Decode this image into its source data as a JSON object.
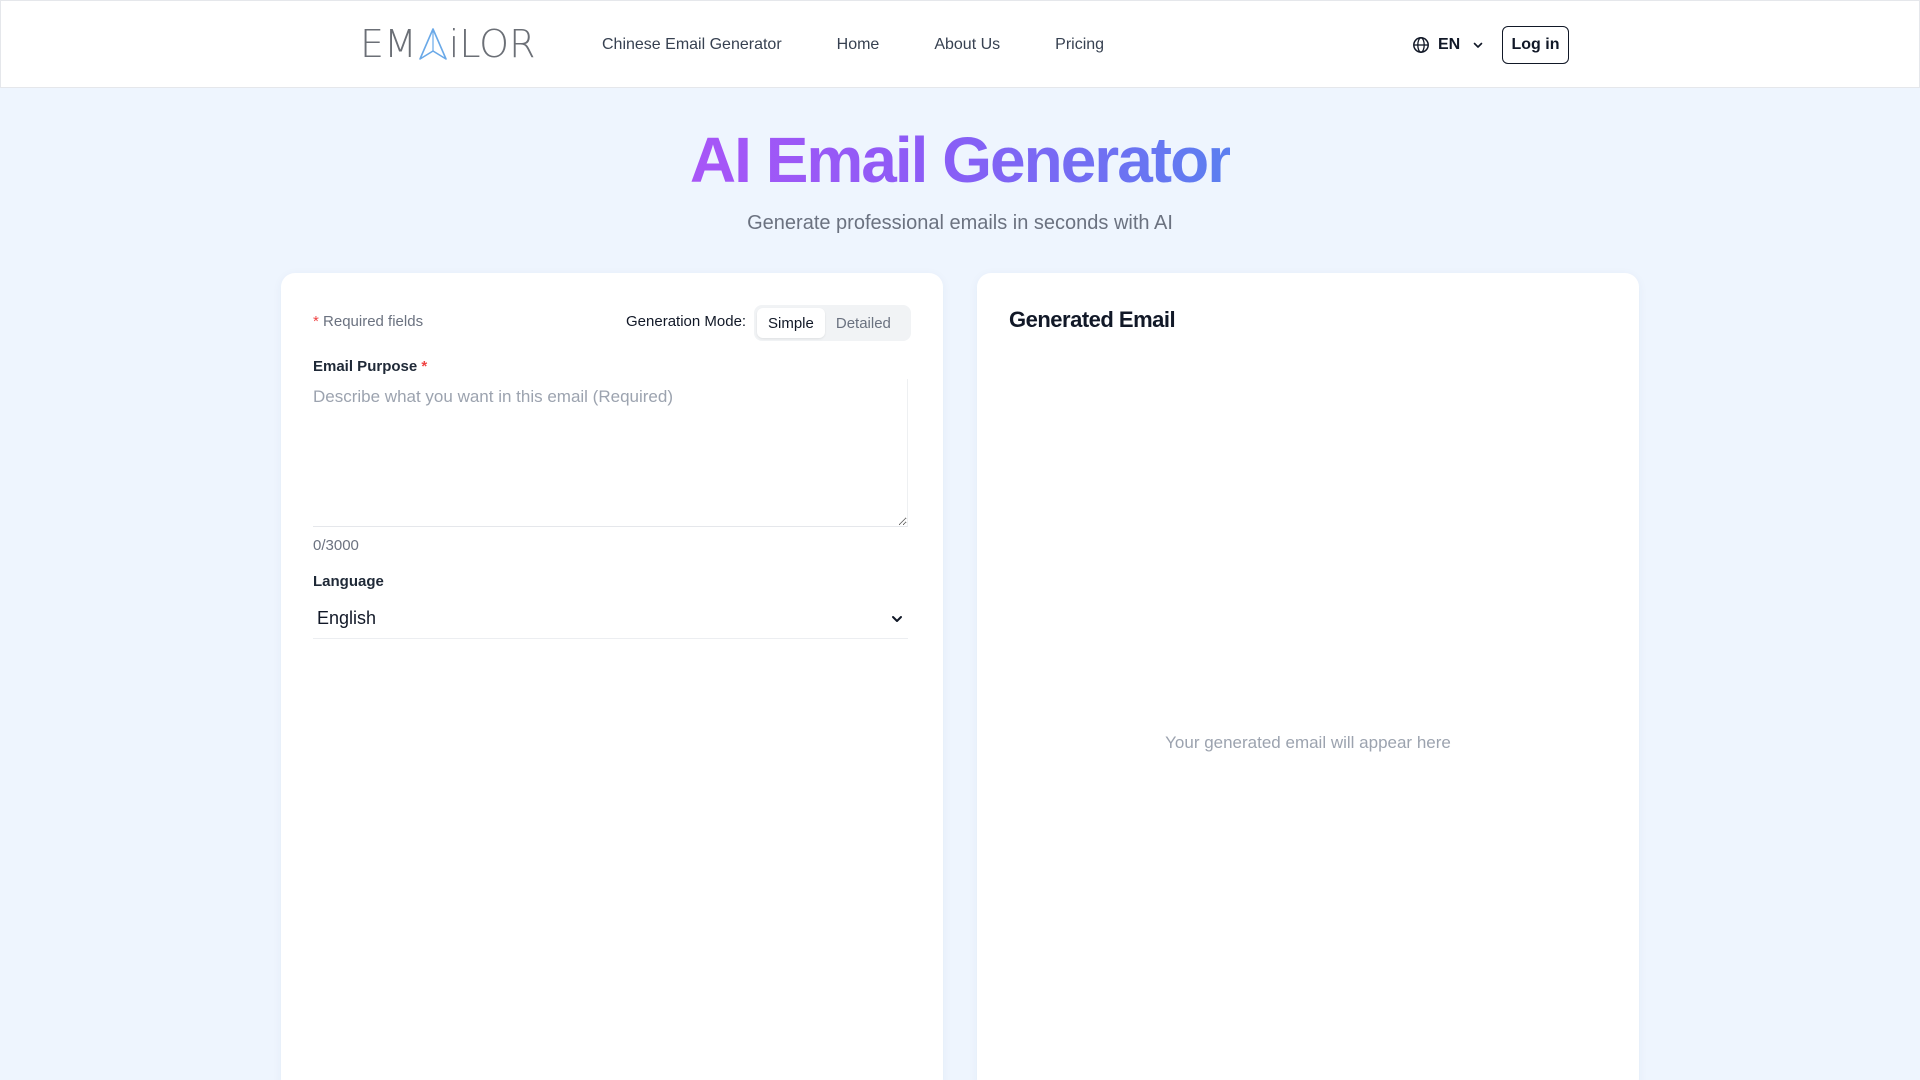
{
  "nav": {
    "logo_text_left": "EM",
    "logo_text_right": "iLOR",
    "links": [
      "Chinese Email Generator",
      "Home",
      "About Us",
      "Pricing"
    ],
    "language": "EN",
    "login_label": "Log in"
  },
  "hero": {
    "title": "AI Email Generator",
    "subtitle": "Generate professional emails in seconds with AI"
  },
  "form": {
    "required_note": "Required fields",
    "required_marker": "*",
    "mode_label": "Generation Mode:",
    "modes": [
      "Simple",
      "Detailed"
    ],
    "active_mode": "Simple",
    "purpose_label": "Email Purpose",
    "purpose_placeholder": "Describe what you want in this email (Required)",
    "purpose_value": "",
    "char_count": "0/3000",
    "language_label": "Language",
    "language_value": "English"
  },
  "output": {
    "title": "Generated Email",
    "placeholder": "Your generated email will appear here"
  },
  "colors": {
    "background": "#eef5fe",
    "title_gradient_start": "#a855f7",
    "title_gradient_end": "#5b7ff0",
    "required_star": "#ef4444"
  },
  "icons": {
    "language": "globe-icon",
    "dropdown": "chevron-down-icon"
  }
}
